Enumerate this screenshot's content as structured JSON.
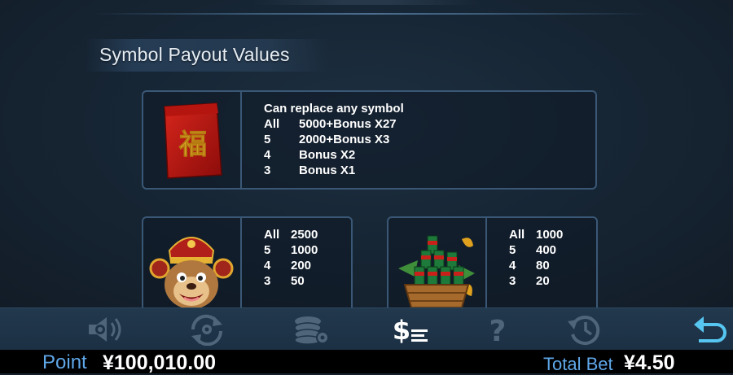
{
  "section_title": "Symbol Payout Values",
  "wild_card": {
    "symbol": "red-envelope-fu",
    "fu_char": "福",
    "rows": [
      {
        "k": "Can replace any symbol",
        "v": ""
      },
      {
        "k": "All",
        "v": "5000+Bonus X27"
      },
      {
        "k": "5",
        "v": "2000+Bonus X3"
      },
      {
        "k": "4",
        "v": "Bonus X2"
      },
      {
        "k": "3",
        "v": "Bonus X1"
      }
    ]
  },
  "card_left": {
    "symbol": "fortune-monkey",
    "rows": [
      {
        "k": "All",
        "v": "2500"
      },
      {
        "k": "5",
        "v": "1000"
      },
      {
        "k": "4",
        "v": "200"
      },
      {
        "k": "3",
        "v": "50"
      }
    ]
  },
  "card_right": {
    "symbol": "firecracker-basket",
    "rows": [
      {
        "k": "All",
        "v": "1000"
      },
      {
        "k": "5",
        "v": "400"
      },
      {
        "k": "4",
        "v": "80"
      },
      {
        "k": "3",
        "v": "20"
      }
    ]
  },
  "toolbar": {
    "icons": [
      "sound-settings-icon",
      "autoplay-settings-icon",
      "bet-chips-icon",
      "paytable-icon",
      "help-icon",
      "history-icon",
      "back-icon"
    ],
    "active": "paytable-icon"
  },
  "status": {
    "point_label": "Point",
    "point_value": "¥100,010.00",
    "total_bet_label": "Total Bet",
    "total_bet_value": "¥4.50"
  },
  "colors": {
    "accent_blue": "#5fa7e8",
    "card_border": "#3a5876",
    "active_icon": "#ffffff",
    "inactive_icon": "#4f6579",
    "back_icon": "#56c6f0"
  }
}
